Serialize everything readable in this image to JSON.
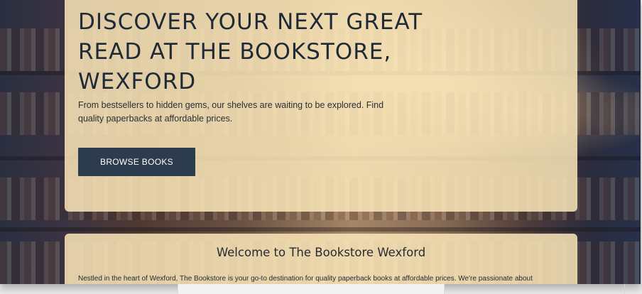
{
  "hero": {
    "title": "DISCOVER YOUR NEXT GREAT READ AT THE BOOKSTORE, WEXFORD",
    "subtitle": "From bestsellers to hidden gems, our shelves are waiting to be explored. Find quality paperbacks at affordable prices.",
    "cta_label": "BROWSE BOOKS"
  },
  "welcome": {
    "title": "Welcome to The Bookstore Wexford",
    "text": "Nestled in the heart of Wexford, The Bookstore is your go-to destination for quality paperback books at affordable prices. We're passionate about"
  },
  "colors": {
    "panel": "#fae7b9",
    "button": "#2c3b4e",
    "text": "#1f2a36"
  }
}
